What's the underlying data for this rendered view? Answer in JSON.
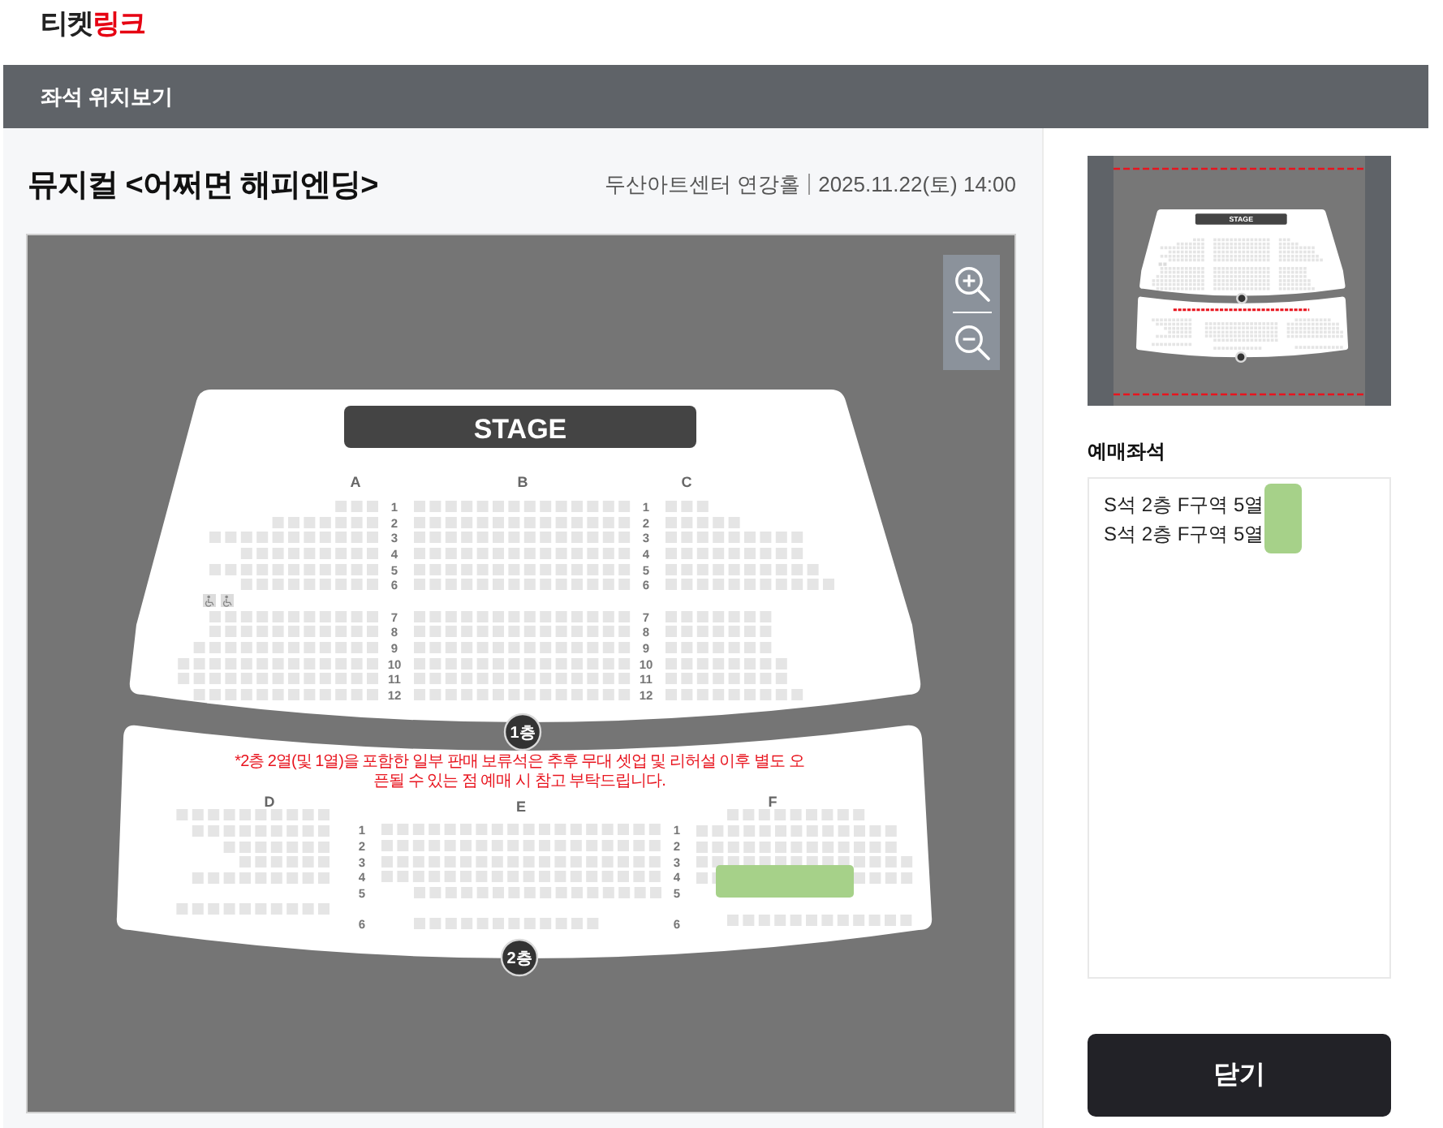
{
  "header": {
    "logo": {
      "dark": "티켓",
      "accent": "링크"
    }
  },
  "title_bar": {
    "title": "좌석 위치보기"
  },
  "event": {
    "title": "뮤지컬 <어쩌면 해피엔딩>",
    "venue": "두산아트센터 연강홀",
    "datetime": "2025.11.22(토) 14:00"
  },
  "zoom_controls": [
    {
      "kind": "zoom_in"
    },
    {
      "kind": "zoom_out"
    }
  ],
  "seat_map": {
    "stage": "STAGE",
    "floors": [
      {
        "label": "1층",
        "sections": [
          {
            "name": "A",
            "highlighted": false
          },
          {
            "name": "B",
            "highlighted": false
          },
          {
            "name": "C",
            "highlighted": false
          }
        ],
        "aisles": [
          {
            "groups": [
              [
                "1",
                "2",
                "3",
                "4",
                "5",
                "6"
              ],
              [
                "7",
                "8",
                "9",
                "10",
                "11",
                "12"
              ]
            ]
          },
          {
            "groups": [
              [
                "1",
                "2",
                "3",
                "4",
                "5",
                "6"
              ],
              [
                "7",
                "8",
                "9",
                "10",
                "11",
                "12"
              ]
            ]
          }
        ]
      },
      {
        "label": "2층",
        "notice": "*2층 2열(및 1열)을 포함한 일부 판매 보류석은 추후 무대 셋업 및 리허설 이후 별도 오픈될 수 있는 점 예매 시 참고 부탁드립니다.",
        "sections": [
          {
            "name": "D",
            "highlighted": false
          },
          {
            "name": "E",
            "highlighted": false
          },
          {
            "name": "F",
            "highlighted": true
          }
        ],
        "aisles": [
          {
            "groups": [
              [
                "1",
                "2",
                "3",
                "4",
                "5"
              ],
              [
                "6"
              ]
            ]
          },
          {
            "groups": [
              [
                "1",
                "2",
                "3",
                "4",
                "5"
              ],
              [
                "6"
              ]
            ]
          }
        ]
      }
    ]
  },
  "minimap": {
    "stage": "STAGE"
  },
  "booking": {
    "heading": "예매좌석",
    "seats": [
      {
        "label": "S석 2층 F구역 5열",
        "highlighted": true
      },
      {
        "label": "S석 2층 F구역 5열",
        "highlighted": true
      }
    ]
  },
  "close_button": {
    "label": "닫기"
  }
}
